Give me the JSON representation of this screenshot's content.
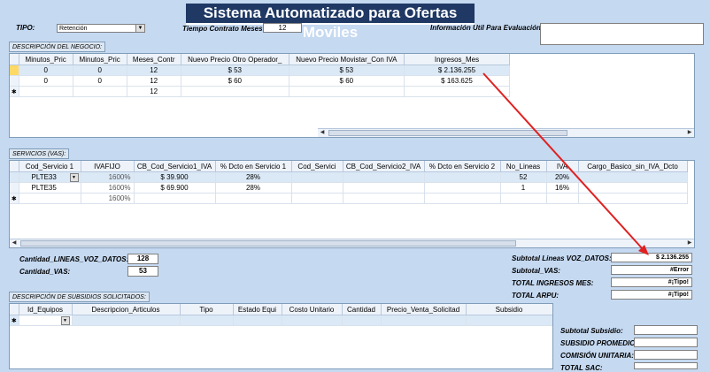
{
  "title": "Sistema Automatizado para Ofertas Moviles",
  "header": {
    "tipo_label": "TIPO:",
    "tipo_value": "Retención",
    "tiempo_label": "Tiempo Contrato Meses:",
    "tiempo_value": "12",
    "info_label": "Información Util Para Evaluación:"
  },
  "negocio": {
    "section_label": "DESCRIPCIÓN DEL NEGOCIO:",
    "columns": [
      "Minutos_Pric",
      "Minutos_Pric",
      "Meses_Contr",
      "Nuevo Precio Otro Operador_",
      "Nuevo Precio Movistar_Con IVA",
      "Ingresos_Mes"
    ],
    "rows": [
      [
        "0",
        "0",
        "12",
        "$ 53",
        "$ 53",
        "$ 2.136.255"
      ],
      [
        "0",
        "0",
        "12",
        "$ 60",
        "$ 60",
        "$ 163.625"
      ],
      [
        "",
        "",
        "12",
        "",
        "",
        ""
      ]
    ],
    "new_marker": "✱"
  },
  "servicios": {
    "section_label": "SERVICIOS (VAS):",
    "columns": [
      "Cod_Servicio 1",
      "IVAFIJO",
      "CB_Cod_Servicio1_IVA",
      "% Dcto en Servicio 1",
      "Cod_Servici",
      "CB_Cod_Servicio2_IVA",
      "% Dcto en Servicio 2",
      "No_Lineas",
      "IVA",
      "Cargo_Basico_sin_IVA_Dcto"
    ],
    "rows": [
      [
        "PLTE33",
        "1600%",
        "$ 39.900",
        "28%",
        "",
        "",
        "",
        "52",
        "20%",
        ""
      ],
      [
        "PLTE35",
        "1600%",
        "$ 69.900",
        "28%",
        "",
        "",
        "",
        "1",
        "16%",
        ""
      ],
      [
        "",
        "1600%",
        "",
        "",
        "",
        "",
        "",
        "",
        "",
        ""
      ]
    ]
  },
  "cantidades": {
    "lineas_label": "Cantidad_LINEAS_VOZ_DATOS:",
    "lineas_value": "128",
    "vas_label": "Cantidad_VAS:",
    "vas_value": "53"
  },
  "subtotales": {
    "voz_label": "Subtotal Lineas VOZ_DATOS:",
    "voz_value": "$ 2.136.255",
    "vas_label": "Subtotal_VAS:",
    "vas_value": "#Error",
    "ingresos_label": "TOTAL INGRESOS MES:",
    "ingresos_value": "#¡Tipo!",
    "arpu_label": "TOTAL ARPU:",
    "arpu_value": "#¡Tipo!"
  },
  "subsidios": {
    "section_label": "DESCRIPCIÓN DE SUBSIDIOS SOLICITADOS:",
    "columns": [
      "Id_Equipos",
      "Descripcion_Articulos",
      "Tipo",
      "Estado Equi",
      "Costo Unitario",
      "Cantidad",
      "Precio_Venta_Solicitad",
      "Subsidio"
    ]
  },
  "totales_subsidio": {
    "subtotal_label": "Subtotal Subsidio:",
    "promedio_label": "SUBSIDIO PROMEDIO:",
    "comision_label": "COMISIÓN UNITARIA:",
    "sac_label": "TOTAL SAC:"
  },
  "colors": {
    "background": "#c5d9f1",
    "title_bar": "#1f3864",
    "arrow": "#e02020",
    "selected_row": "#dbe9f7"
  }
}
